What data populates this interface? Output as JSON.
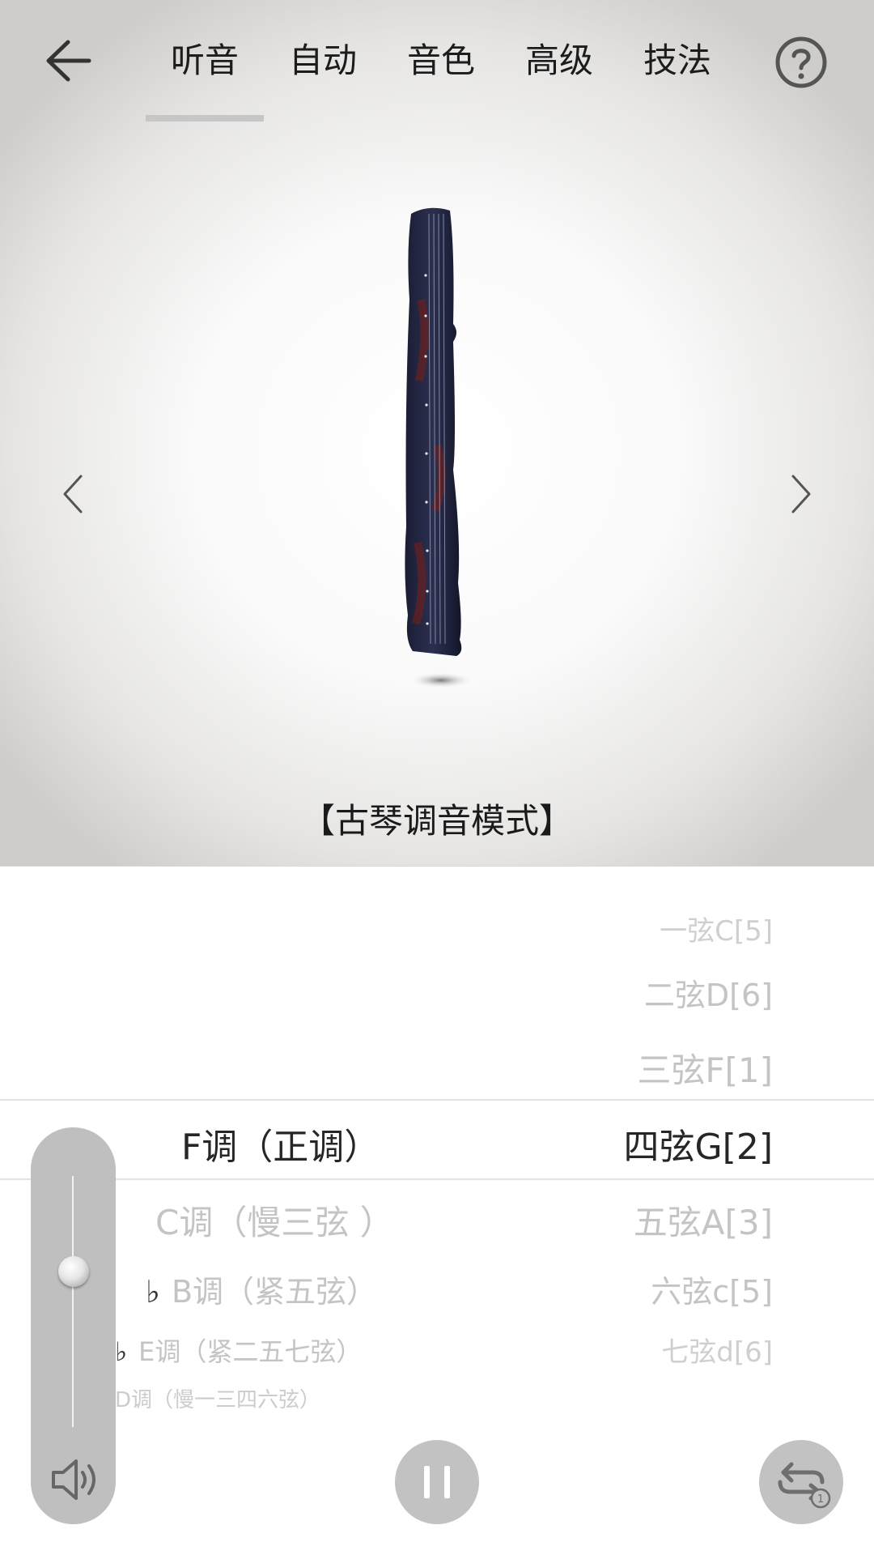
{
  "header": {
    "tabs": [
      {
        "label": "听音",
        "active": true
      },
      {
        "label": "自动",
        "active": false
      },
      {
        "label": "音色",
        "active": false
      },
      {
        "label": "高级",
        "active": false
      },
      {
        "label": "技法",
        "active": false
      }
    ]
  },
  "stage": {
    "mode_title": "【古琴调音模式】"
  },
  "strings": [
    {
      "label": "一弦C",
      "note": "5",
      "dot": "below",
      "selected": false
    },
    {
      "label": "二弦D",
      "note": "6",
      "dot": "below",
      "selected": false
    },
    {
      "label": "三弦F",
      "note": "1",
      "dot": "none",
      "selected": false
    },
    {
      "label": "四弦G",
      "note": "2",
      "dot": "none",
      "selected": true
    },
    {
      "label": "五弦A",
      "note": "3",
      "dot": "none",
      "selected": false
    },
    {
      "label": "六弦c",
      "note": "5",
      "dot": "none",
      "selected": false
    },
    {
      "label": "七弦d",
      "note": "6",
      "dot": "none",
      "selected": false
    }
  ],
  "keys": [
    {
      "flat": "",
      "label": "F调（正调）",
      "selected": true
    },
    {
      "flat": "",
      "label": "C调（慢三弦 ）",
      "selected": false
    },
    {
      "flat": "♭",
      "label": "B调（紧五弦）",
      "selected": false
    },
    {
      "flat": "♭",
      "label": "E调（紧二五七弦）",
      "selected": false
    },
    {
      "flat": "",
      "label": "D调（慢一三四六弦）",
      "selected": false
    }
  ],
  "controls": {
    "volume_level": 0.62
  },
  "colors": {
    "selected_text": "#262626",
    "faded_text": "#c4c4c4",
    "control_gray": "#bfbfbf"
  },
  "icons": [
    "back-arrow-icon",
    "help-circle-icon",
    "chevron-left-icon",
    "chevron-right-icon",
    "speaker-icon",
    "pause-icon",
    "repeat-one-icon"
  ]
}
